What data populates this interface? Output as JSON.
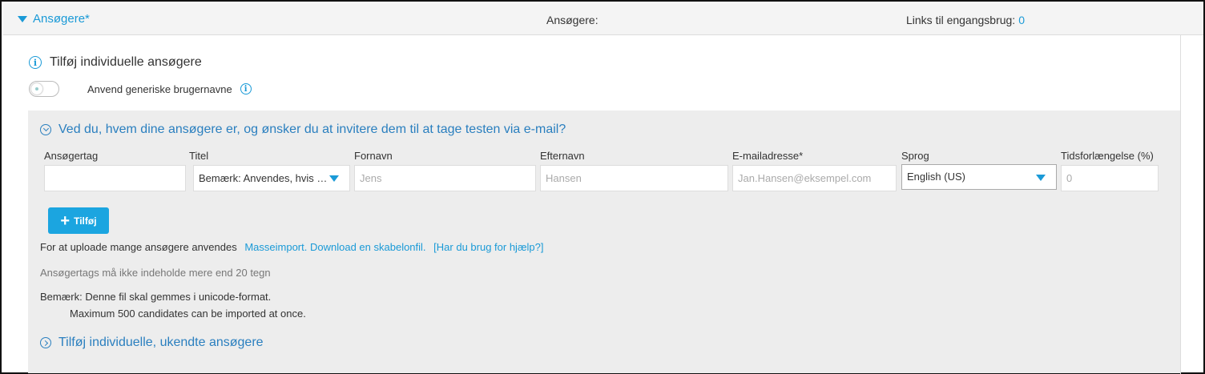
{
  "header": {
    "toggle_label": "Ansøgere*",
    "middle_label": "Ansøgere:",
    "links_label": "Links til engangsbrug:",
    "links_count": "0"
  },
  "section": {
    "title": "Tilføj individuelle ansøgere",
    "generic_toggle_label": "Anvend generiske brugernavne"
  },
  "invite_panel": {
    "heading": "Ved du, hvem dine ansøgere er, og ønsker du at invitere dem til at tage testen via e-mail?",
    "fields": {
      "tag": {
        "label": "Ansøgertag",
        "value": ""
      },
      "title": {
        "label": "Titel",
        "value": "Bemærk: Anvendes, hvis en ansøger ikke har en titel"
      },
      "first_name": {
        "label": "Fornavn",
        "placeholder": "Jens"
      },
      "last_name": {
        "label": "Efternavn",
        "placeholder": "Hansen"
      },
      "email": {
        "label": "E-mailadresse*",
        "placeholder": "Jan.Hansen@eksempel.com"
      },
      "language": {
        "label": "Sprog",
        "value": "English (US)"
      },
      "time_ext": {
        "label": "Tidsforlængelse (%)",
        "placeholder": "0"
      }
    },
    "add_button_label": "Tilføj",
    "upload_text": "For at uploade mange ansøgere anvendes",
    "mass_import_link": "Masseimport.",
    "download_template_link": "Download en skabelonfil.",
    "help_link": "[Har du brug for hjælp?]",
    "tag_limit_note": "Ansøgertags må ikke indeholde mere end 20 tegn",
    "note_line1": "Bemærk: Denne fil skal gemmes i unicode-format.",
    "note_line2": "Maximum 500 candidates can be imported at once."
  },
  "unknown_panel": {
    "heading": "Tilføj individuelle, ukendte ansøgere"
  },
  "colors": {
    "accent": "#1a9ad7",
    "button": "#1ba5e0",
    "panel_bg": "#ededed",
    "header_bg": "#f4f4f4"
  }
}
